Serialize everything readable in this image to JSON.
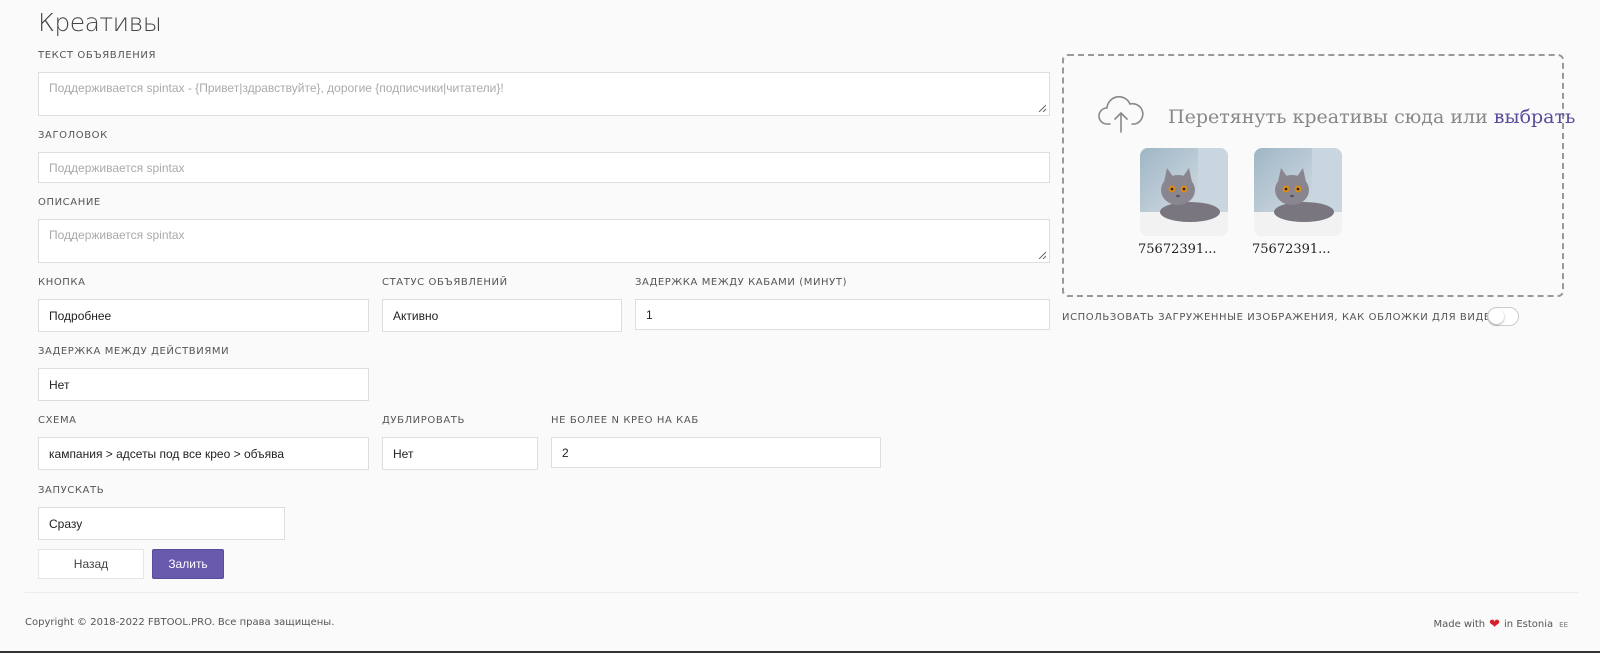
{
  "page": {
    "title": "Креативы"
  },
  "form": {
    "ad_text": {
      "label": "Текст объявления",
      "placeholder": "Поддерживается spintax - {Привет|здравствуйте}, дорогие {подписчики|читатели}!"
    },
    "headline": {
      "label": "Заголовок",
      "placeholder": "Поддерживается spintax"
    },
    "description": {
      "label": "Описание",
      "placeholder": "Поддерживается spintax"
    },
    "button": {
      "label": "Кнопка",
      "value": "Подробнее"
    },
    "ad_status": {
      "label": "Статус объявлений",
      "value": "Активно"
    },
    "cab_delay": {
      "label": "Задержка между кабами (минут)",
      "value": "1"
    },
    "action_delay": {
      "label": "Задержка между действиями",
      "value": "Нет"
    },
    "scheme": {
      "label": "Схема",
      "value": "кампания > адсеты под все крео > объява"
    },
    "duplicate": {
      "label": "Дублировать",
      "value": "Нет"
    },
    "max_creo": {
      "label": "Не более N крео на каб",
      "value": "2"
    },
    "launch": {
      "label": "Запускать",
      "value": "Сразу"
    },
    "back_label": "Назад",
    "submit_label": "Залить"
  },
  "dropzone": {
    "text": "Перетянуть креативы сюда или",
    "link": "выбрать",
    "icon": "cloud-upload-icon",
    "files": [
      {
        "name": "75672391..."
      },
      {
        "name": "75672391..."
      }
    ]
  },
  "video_cover": {
    "label": "Использовать загруженные изображения, как обложки для видео?",
    "enabled": false
  },
  "footer": {
    "copyright": "Copyright © 2018-2022 FBTOOL.PRO. Все права защищены.",
    "made_with": "Made with",
    "in_country": "in Estonia",
    "flag": "EE"
  },
  "colors": {
    "accent": "#6a5aad",
    "heart": "#d81e2a"
  }
}
